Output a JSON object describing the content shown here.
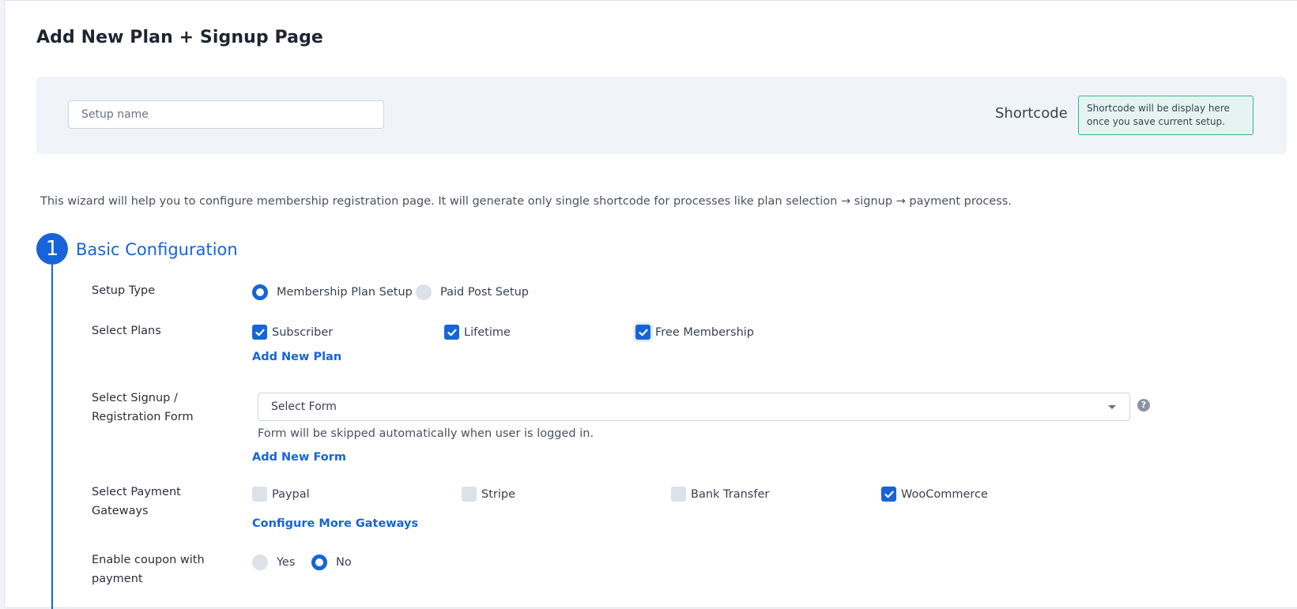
{
  "page": {
    "title": "Add New Plan + Signup Page"
  },
  "setup": {
    "name_placeholder": "Setup name",
    "shortcode_label": "Shortcode",
    "shortcode_message": "Shortcode will be display here once you save current setup."
  },
  "intro": "This wizard will help you to configure membership registration page. It will generate only single shortcode for processes like plan selection → signup → payment process.",
  "step": {
    "number": "1",
    "title": "Basic Configuration"
  },
  "setup_type": {
    "label": "Setup Type",
    "options": [
      {
        "label": "Membership Plan Setup",
        "selected": true
      },
      {
        "label": "Paid Post Setup",
        "selected": false
      }
    ]
  },
  "plans": {
    "label": "Select Plans",
    "options": [
      {
        "label": "Subscriber",
        "checked": true
      },
      {
        "label": "Lifetime",
        "checked": true
      },
      {
        "label": "Free Membership",
        "checked": true
      }
    ],
    "add_link": "Add New Plan"
  },
  "form": {
    "label": "Select Signup / Registration Form",
    "select_value": "Select Form",
    "help_icon": "?",
    "hint": "Form will be skipped automatically when user is logged in.",
    "add_link": "Add New Form"
  },
  "gateways": {
    "label": "Select Payment Gateways",
    "options": [
      {
        "label": "Paypal",
        "checked": false
      },
      {
        "label": "Stripe",
        "checked": false
      },
      {
        "label": "Bank Transfer",
        "checked": false
      },
      {
        "label": "WooCommerce",
        "checked": true
      }
    ],
    "configure_link": "Configure More Gateways"
  },
  "coupon": {
    "label": "Enable coupon with payment",
    "options": [
      {
        "label": "Yes",
        "selected": false
      },
      {
        "label": "No",
        "selected": true
      }
    ]
  },
  "colors": {
    "accent": "#1565d8",
    "shortcode_border": "#2bb99b",
    "panel_bg": "#f0f3f8"
  }
}
